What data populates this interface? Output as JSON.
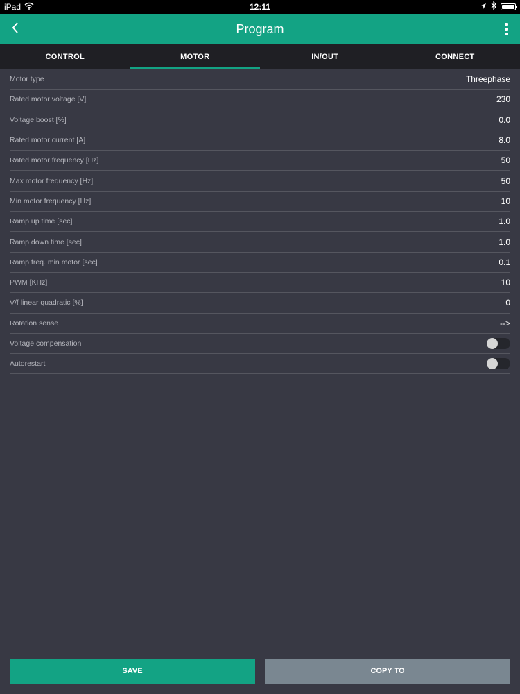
{
  "status_bar": {
    "device": "iPad",
    "time": "12:11"
  },
  "header": {
    "title": "Program",
    "back_icon": "chevron-left-icon",
    "menu_icon": "more-vertical-icon"
  },
  "tabs": [
    {
      "label": "CONTROL",
      "active": false
    },
    {
      "label": "MOTOR",
      "active": true
    },
    {
      "label": "IN/OUT",
      "active": false
    },
    {
      "label": "CONNECT",
      "active": false
    }
  ],
  "settings": [
    {
      "label": "Motor type",
      "value": "Threephase"
    },
    {
      "label": "Rated motor voltage [V]",
      "value": "230"
    },
    {
      "label": "Voltage boost [%]",
      "value": "0.0"
    },
    {
      "label": "Rated motor current [A]",
      "value": "8.0"
    },
    {
      "label": "Rated motor frequency [Hz]",
      "value": "50"
    },
    {
      "label": "Max motor frequency [Hz]",
      "value": "50"
    },
    {
      "label": "Min motor frequency [Hz]",
      "value": "10"
    },
    {
      "label": "Ramp up time [sec]",
      "value": "1.0"
    },
    {
      "label": "Ramp down time [sec]",
      "value": "1.0"
    },
    {
      "label": "Ramp freq. min motor [sec]",
      "value": "0.1"
    },
    {
      "label": "PWM [KHz]",
      "value": "10"
    },
    {
      "label": "V/f linear quadratic [%]",
      "value": "0"
    },
    {
      "label": "Rotation sense",
      "value": "-->"
    },
    {
      "label": "Voltage compensation",
      "toggle": false
    },
    {
      "label": "Autorestart",
      "toggle": false
    }
  ],
  "footer": {
    "save_label": "SAVE",
    "copy_label": "COPY TO"
  },
  "colors": {
    "accent": "#13a384",
    "background": "#383944",
    "tabbar": "#1f1f24",
    "copy_button": "#7a8791"
  }
}
